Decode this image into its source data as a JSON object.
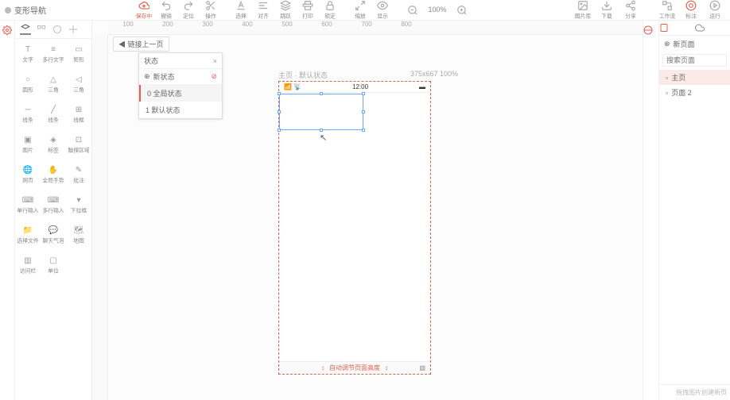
{
  "app": {
    "title": "变形导航"
  },
  "toolbar": {
    "save": "保存中",
    "undo": "撤销",
    "redo": "定位",
    "action": "操作",
    "font": "选择",
    "align": "对齐",
    "bring": "跳跃",
    "print": "打印",
    "lock": "锁定",
    "zoom": "缩放",
    "display": "显示",
    "zoom_val": "100%",
    "pic": "图片库",
    "download": "下载",
    "share": "分享",
    "workflow": "工作流",
    "annotate": "标注",
    "run": "运行"
  },
  "components": [
    {
      "l": "文字"
    },
    {
      "l": "多行文字"
    },
    {
      "l": "矩形"
    },
    {
      "l": "圆形"
    },
    {
      "l": "三角"
    },
    {
      "l": "三角"
    },
    {
      "l": "线条"
    },
    {
      "l": "线条"
    },
    {
      "l": "线框"
    },
    {
      "l": "图片"
    },
    {
      "l": "标签"
    },
    {
      "l": "触摸区域"
    },
    {
      "l": "网页"
    },
    {
      "l": "全局手势"
    },
    {
      "l": "批注"
    },
    {
      "l": "单行输入"
    },
    {
      "l": "多行输入"
    },
    {
      "l": "下拉框"
    },
    {
      "l": "选择文件"
    },
    {
      "l": "聊天气泡"
    },
    {
      "l": "地图"
    },
    {
      "l": "访问栏"
    },
    {
      "l": "单位"
    }
  ],
  "crumb": "链接上一页",
  "status_panel": {
    "title": "状态",
    "new": "新状态",
    "rows": [
      "0  全局状态",
      "1  默认状态"
    ]
  },
  "artboard": {
    "label": "主页 · 默认状态",
    "dim": "375x667  100%",
    "time": "12:00",
    "footer": "自动调节页面高度"
  },
  "right": {
    "new_page": "新页面",
    "search_ph": "搜索页面",
    "pages": [
      "主页",
      "页面 2"
    ],
    "footer": "拖拽图片创建新页"
  },
  "ruler": [
    "100",
    "200",
    "300",
    "400",
    "500",
    "600",
    "700",
    "800"
  ]
}
